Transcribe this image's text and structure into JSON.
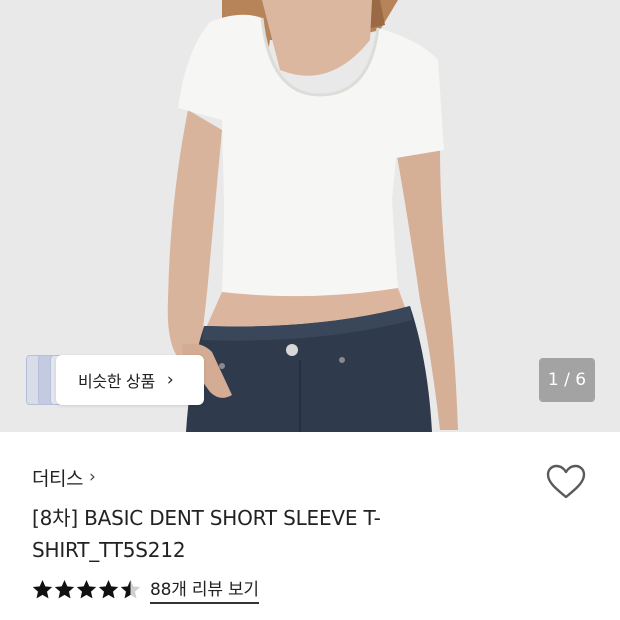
{
  "hero": {
    "similar_products_label": "비슷한 상품",
    "similar_chevron": "›",
    "page_counter": "1 / 6"
  },
  "product": {
    "brand": "더티스",
    "brand_chevron": "›",
    "title": "[8차] BASIC DENT SHORT SLEEVE T-SHIRT_TT5S212",
    "rating": 4.5,
    "rating_max": 5,
    "review_link": "88개 리뷰 보기"
  },
  "icons": {
    "heart": "heart-icon",
    "star": "star-icon"
  },
  "colors": {
    "star_fill": "#111111",
    "star_empty": "#cfcfcf",
    "counter_bg": "#787878"
  }
}
